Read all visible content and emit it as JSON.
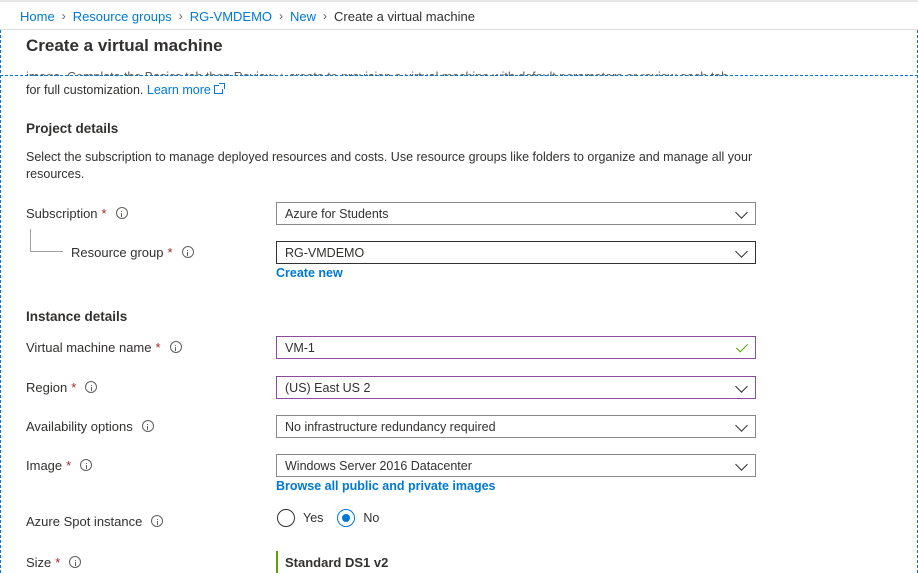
{
  "breadcrumb": {
    "items": [
      "Home",
      "Resource groups",
      "RG-VMDEMO",
      "New"
    ],
    "current": "Create a virtual machine"
  },
  "page": {
    "title": "Create a virtual machine",
    "intro_cut": "image. Complete the Basics tab then Review + create to provision a virtual machine with default parameters or review each tab",
    "intro_line2": "for full customization.",
    "learn_more": "Learn more"
  },
  "project": {
    "title": "Project details",
    "desc": "Select the subscription to manage deployed resources and costs. Use resource groups like folders to organize and manage all your resources.",
    "subscription_label": "Subscription",
    "subscription_value": "Azure for Students",
    "rg_label": "Resource group",
    "rg_value": "RG-VMDEMO",
    "create_new": "Create new"
  },
  "instance": {
    "title": "Instance details",
    "vm_name_label": "Virtual machine name",
    "vm_name_value": "VM-1",
    "region_label": "Region",
    "region_value": "(US) East US 2",
    "availability_label": "Availability options",
    "availability_value": "No infrastructure redundancy required",
    "image_label": "Image",
    "image_value": "Windows Server 2016 Datacenter",
    "browse_images": "Browse all public and private images",
    "spot_label": "Azure Spot instance",
    "spot_yes": "Yes",
    "spot_no": "No",
    "size_label": "Size",
    "size_value": "Standard DS1 v2"
  },
  "required_mark": "*",
  "colors": {
    "link": "#0078d4",
    "required": "#a4262c",
    "valid": "#57a300",
    "focus_border": "#8a4d9c"
  }
}
